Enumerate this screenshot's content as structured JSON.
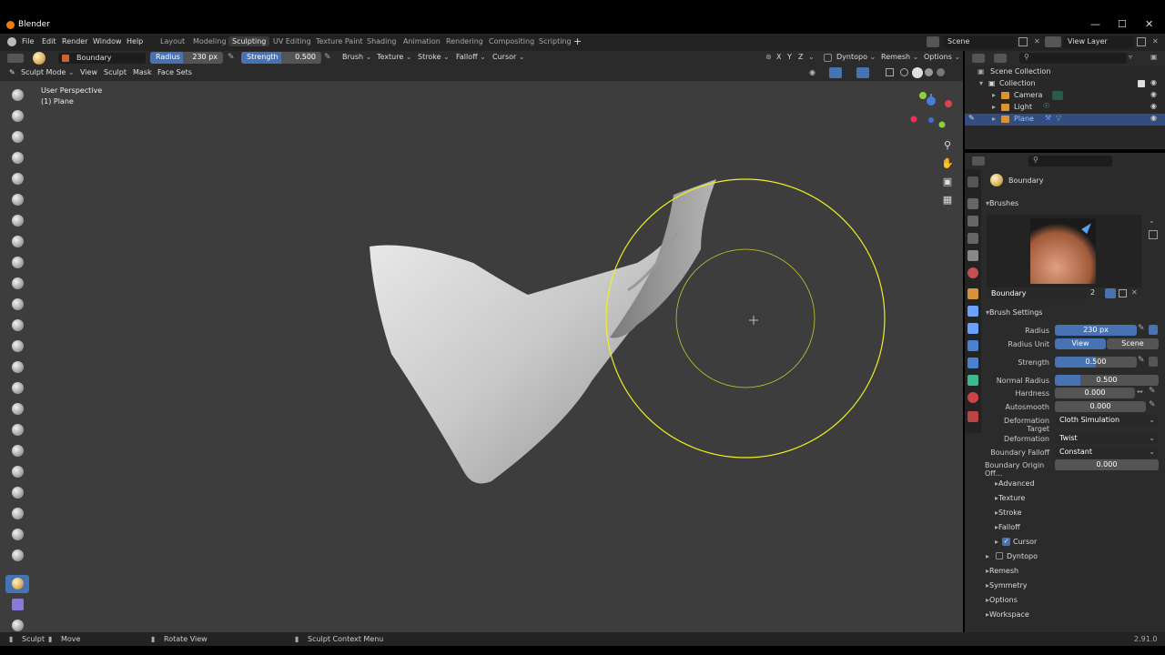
{
  "window": {
    "title": "Blender"
  },
  "menu": [
    "File",
    "Edit",
    "Render",
    "Window",
    "Help"
  ],
  "workspaces": [
    "Layout",
    "Modeling",
    "Sculpting",
    "UV Editing",
    "Texture Paint",
    "Shading",
    "Animation",
    "Rendering",
    "Compositing",
    "Scripting"
  ],
  "active_workspace": "Sculpting",
  "scene": {
    "scene_name": "Scene",
    "view_layer": "View Layer"
  },
  "toolheader": {
    "brush_name": "Boundary",
    "radius_label": "Radius",
    "radius_value": "230 px",
    "strength_label": "Strength",
    "strength_value": "0.500",
    "menus": [
      "Brush",
      "Texture",
      "Stroke",
      "Falloff",
      "Cursor"
    ],
    "axes": [
      "X",
      "Y",
      "Z"
    ],
    "right": [
      "Dyntopo",
      "Remesh",
      "Options"
    ]
  },
  "modeheader": {
    "mode": "Sculpt Mode",
    "menus": [
      "View",
      "Sculpt",
      "Mask",
      "Face Sets"
    ]
  },
  "viewport": {
    "perspective": "User Perspective",
    "object": "(1) Plane"
  },
  "outliner": {
    "rows": [
      {
        "label": "Scene Collection",
        "indent": 0
      },
      {
        "label": "Collection",
        "indent": 1
      },
      {
        "label": "Camera",
        "indent": 2
      },
      {
        "label": "Light",
        "indent": 2
      },
      {
        "label": "Plane",
        "indent": 2,
        "selected": true
      }
    ]
  },
  "properties": {
    "brush_title": "Boundary",
    "brushes_panel": "Brushes",
    "brush_slot_name": "Boundary",
    "brush_users": "2",
    "brush_settings_panel": "Brush Settings",
    "fields": {
      "radius": {
        "label": "Radius",
        "value": "230 px"
      },
      "radius_unit": {
        "label": "Radius Unit",
        "options": [
          "View",
          "Scene"
        ]
      },
      "strength": {
        "label": "Strength",
        "value": "0.500"
      },
      "normal_radius": {
        "label": "Normal Radius",
        "value": "0.500"
      },
      "hardness": {
        "label": "Hardness",
        "value": "0.000"
      },
      "autosmooth": {
        "label": "Autosmooth",
        "value": "0.000"
      },
      "deformation_target": {
        "label": "Deformation Target",
        "value": "Cloth Simulation"
      },
      "deformation": {
        "label": "Deformation",
        "value": "Twist"
      },
      "boundary_falloff": {
        "label": "Boundary Falloff",
        "value": "Constant"
      },
      "boundary_origin_offset": {
        "label": "Boundary Origin Off...",
        "value": "0.000"
      }
    },
    "subpanels": [
      "Advanced",
      "Texture",
      "Stroke",
      "Falloff",
      "Cursor"
    ],
    "panels": [
      "Dyntopo",
      "Remesh",
      "Symmetry",
      "Options",
      "Workspace"
    ]
  },
  "statusbar": {
    "left1": "Sculpt",
    "left2": "Move",
    "mid": "Rotate View",
    "ctx": "Sculpt Context Menu",
    "version": "2.91.0"
  }
}
